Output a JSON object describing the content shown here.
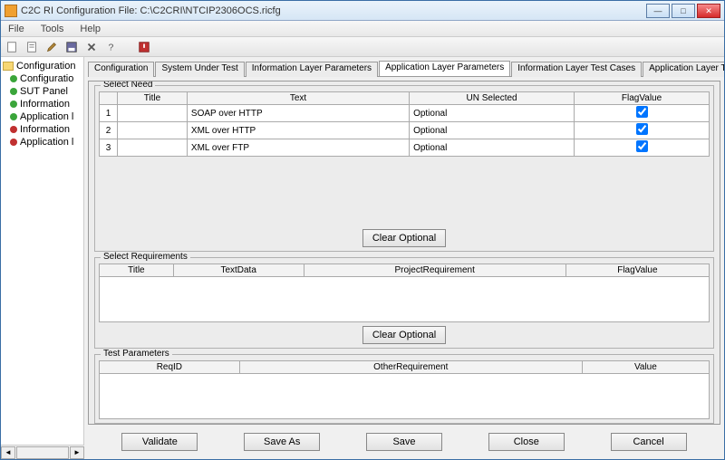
{
  "title": "C2C RI   Configuration File:  C:\\C2CRI\\NTCIP2306OCS.ricfg",
  "menu": {
    "file": "File",
    "tools": "Tools",
    "help": "Help"
  },
  "tree": {
    "root": "Configuration",
    "items": [
      {
        "label": "Configuratio",
        "status": "green"
      },
      {
        "label": "SUT Panel",
        "status": "green"
      },
      {
        "label": "Information",
        "status": "green"
      },
      {
        "label": "Application l",
        "status": "green"
      },
      {
        "label": "Information",
        "status": "red"
      },
      {
        "label": "Application l",
        "status": "red"
      }
    ]
  },
  "tabs": [
    "Configuration",
    "System Under Test",
    "Information Layer Parameters",
    "Application Layer Parameters",
    "Information Layer Test Cases",
    "Application Layer Test Cases"
  ],
  "activeTab": 3,
  "needs": {
    "legend": "Select Need",
    "headers": [
      "",
      "Title",
      "Text",
      "UN Selected",
      "FlagValue"
    ],
    "rows": [
      {
        "n": "1",
        "title": "",
        "text": "SOAP over HTTP",
        "un": "Optional",
        "flag": true
      },
      {
        "n": "2",
        "title": "",
        "text": "XML over HTTP",
        "un": "Optional",
        "flag": true
      },
      {
        "n": "3",
        "title": "",
        "text": "XML over FTP",
        "un": "Optional",
        "flag": true
      }
    ],
    "clear": "Clear Optional"
  },
  "reqs": {
    "legend": "Select Requirements",
    "headers": [
      "Title",
      "TextData",
      "ProjectRequirement",
      "FlagValue"
    ],
    "clear": "Clear Optional"
  },
  "tparams": {
    "legend": "Test Parameters",
    "headers": [
      "ReqID",
      "OtherRequirement",
      "Value"
    ]
  },
  "buttons": {
    "validate": "Validate",
    "saveas": "Save As",
    "save": "Save",
    "close": "Close",
    "cancel": "Cancel"
  }
}
